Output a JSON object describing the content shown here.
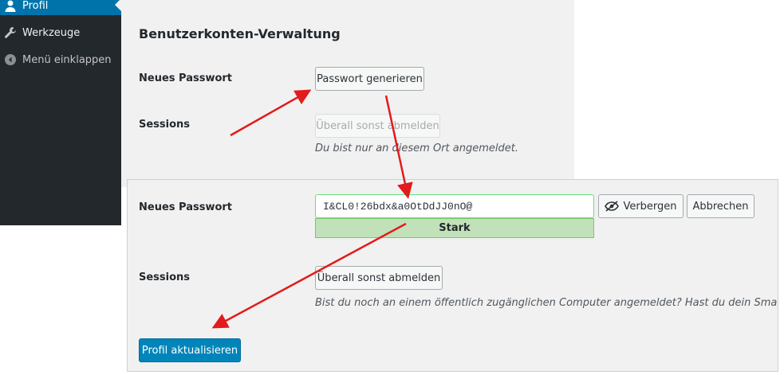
{
  "sidebar": {
    "items": [
      {
        "label": "Profil",
        "icon": "user-icon"
      },
      {
        "label": "Werkzeuge",
        "icon": "wrench-icon"
      },
      {
        "label": "Menü einklappen",
        "icon": "collapse-icon"
      }
    ]
  },
  "account_management": {
    "title": "Benutzerkonten-Verwaltung",
    "new_password_label": "Neues Passwort",
    "generate_button": "Passwort generieren",
    "sessions_label": "Sessions",
    "logout_elsewhere_button": "Überall sonst abmelden",
    "sessions_description": "Du bist nur an diesem Ort angemeldet."
  },
  "password_form": {
    "new_password_label": "Neues Passwort",
    "password_value": "I&CL0!26bdx&a0OtDdJJ0nO@",
    "hide_button": "Verbergen",
    "cancel_button": "Abbrechen",
    "strength_text": "Stark",
    "sessions_label": "Sessions",
    "logout_elsewhere_button": "Überall sonst abmelden",
    "sessions_description": "Bist du noch an einem öffentlich zugänglichen Computer angemeldet? Hast du dein Smartphone verloren?",
    "update_button": "Profil aktualisieren"
  },
  "colors": {
    "sidebar_bg": "#23282d",
    "active_menu": "#0073aa",
    "primary_button": "#0085ba",
    "strength_strong": "#c1e1b9",
    "arrow": "#e21b1b"
  }
}
